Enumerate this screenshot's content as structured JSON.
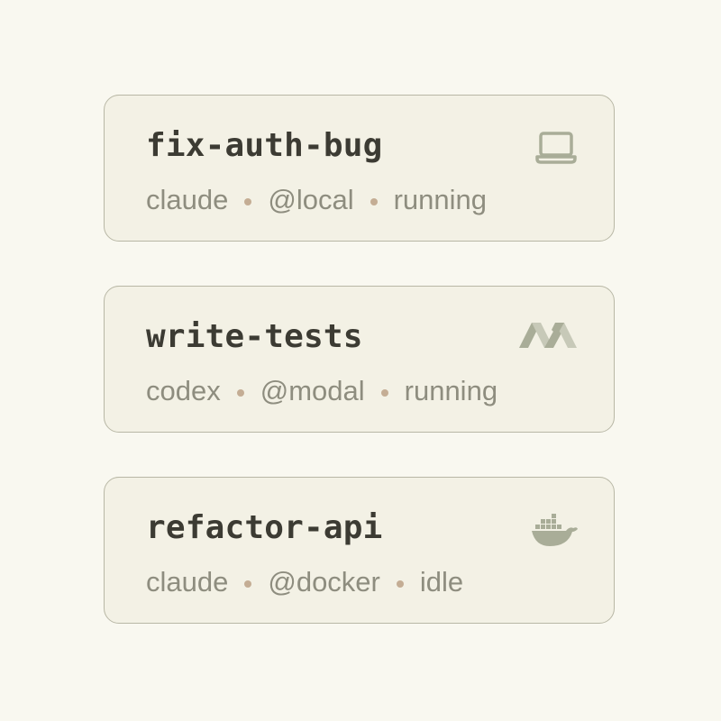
{
  "colors": {
    "background": "#f9f8f0",
    "card_background": "#f3f1e5",
    "card_border": "#b8b7a5",
    "title_text": "#3c3b33",
    "meta_text": "#8e8d7f",
    "separator_dot": "#c4ad94",
    "icon": "#a9ad98"
  },
  "sessions": [
    {
      "name": "fix-auth-bug",
      "agent": "claude",
      "host": "@local",
      "status": "running",
      "icon": "laptop-icon"
    },
    {
      "name": "write-tests",
      "agent": "codex",
      "host": "@modal",
      "status": "running",
      "icon": "modal-logo-icon"
    },
    {
      "name": "refactor-api",
      "agent": "claude",
      "host": "@docker",
      "status": "idle",
      "icon": "docker-whale-icon"
    }
  ]
}
